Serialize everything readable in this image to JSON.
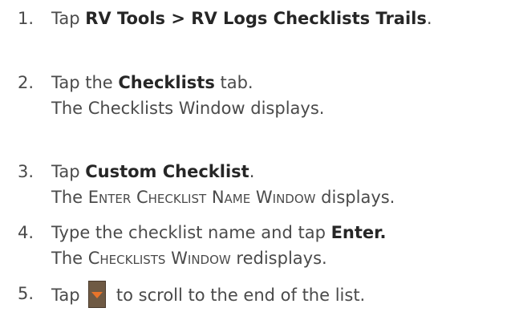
{
  "steps": [
    {
      "number": "1.",
      "text": "Tap ",
      "bold": "RV Tools > RV Logs Checklists Trails",
      "after": "."
    },
    {
      "number": "2.",
      "text": "Tap the ",
      "bold": "Checklists",
      "after": " tab.",
      "result_prefix": "The Checklists Window displays."
    },
    {
      "number": "3.",
      "text": "Tap ",
      "bold": "Custom Checklist",
      "after": ".",
      "result_prefix": "The ",
      "result_caps": "Enter Checklist Name Window",
      "result_suffix": " displays."
    },
    {
      "number": "4.",
      "text": "Type the checklist name and tap ",
      "bold": "Enter.",
      "result_prefix": "The ",
      "result_caps": "Checklists Window",
      "result_suffix": " redisplays."
    },
    {
      "number": "5.",
      "text": "Tap ",
      "after": " to scroll to the end of the list.",
      "icon": "scroll-down-button-icon"
    }
  ],
  "colors": {
    "text": "#4a4a4a",
    "scroll_button": "#6f5a44",
    "scroll_arrow": "#e8742a"
  }
}
